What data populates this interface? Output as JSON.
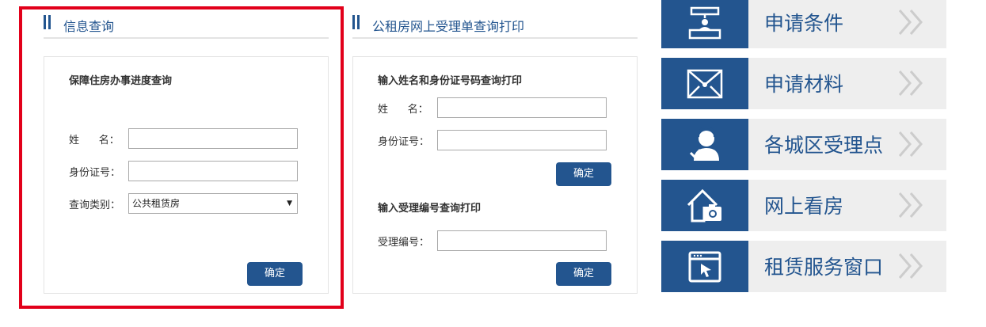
{
  "left": {
    "header": "信息查询",
    "panel_title": "保障住房办事进度查询",
    "name_label": "姓      名：",
    "id_label": "身份证号：",
    "type_label": "查询类别：",
    "type_value": "公共租赁房",
    "name_value": "",
    "id_value": "",
    "submit": "确定"
  },
  "middle": {
    "header": "公租房网上受理单查询打印",
    "panel1_title": "输入姓名和身份证号码查询打印",
    "name_label": "姓      名：",
    "id_label": "身份证号：",
    "submit1": "确定",
    "panel2_title": "输入受理编号查询打印",
    "code_label": "受理编号：",
    "submit2": "确定",
    "name_value": "",
    "id_value": "",
    "code_value": ""
  },
  "menu": [
    {
      "label": "申请条件",
      "icon": "reception-desk-icon"
    },
    {
      "label": "申请材料",
      "icon": "envelope-icon"
    },
    {
      "label": "各城区受理点",
      "icon": "service-agent-icon"
    },
    {
      "label": "网上看房",
      "icon": "house-camera-icon"
    },
    {
      "label": "租赁服务窗口",
      "icon": "browser-window-cursor-icon"
    }
  ],
  "colors": {
    "brand": "#23558f",
    "highlight": "#e2001a",
    "menu_bg": "#eeeeee",
    "chevron": "#cccccc"
  }
}
